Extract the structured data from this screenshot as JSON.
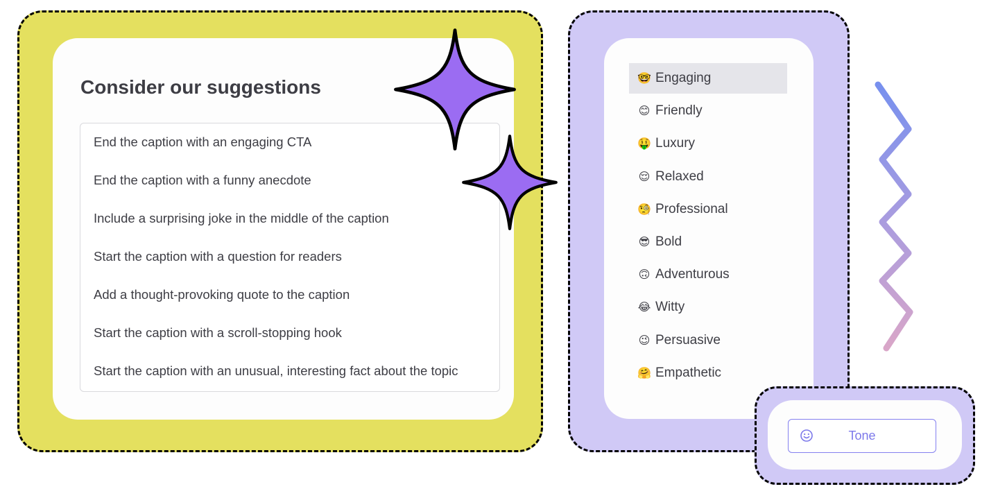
{
  "suggestions": {
    "title": "Consider our suggestions",
    "items": [
      "End the caption with an engaging CTA",
      "End the caption with a funny anecdote",
      "Include a surprising joke in the middle of the caption",
      "Start the caption with a question for readers",
      "Add a thought-provoking quote to the caption",
      "Start the caption with a scroll-stopping hook",
      "Start the caption with an unusual, interesting fact about the topic"
    ]
  },
  "tones": {
    "selected": "Engaging",
    "items": [
      {
        "emoji": "🤓",
        "icon": "nerd-face-icon",
        "label": "Engaging"
      },
      {
        "emoji": "😊",
        "icon": "smiling-face-icon",
        "label": "Friendly"
      },
      {
        "emoji": "🤑",
        "icon": "money-mouth-face-icon",
        "label": "Luxury"
      },
      {
        "emoji": "😌",
        "icon": "relieved-face-icon",
        "label": "Relaxed"
      },
      {
        "emoji": "🧐",
        "icon": "monocle-face-icon",
        "label": "Professional"
      },
      {
        "emoji": "😎",
        "icon": "sunglasses-face-icon",
        "label": "Bold"
      },
      {
        "emoji": "🙃",
        "icon": "upside-down-face-icon",
        "label": "Adventurous"
      },
      {
        "emoji": "😂",
        "icon": "tears-of-joy-face-icon",
        "label": "Witty"
      },
      {
        "emoji": "😉",
        "icon": "winking-face-icon",
        "label": "Persuasive"
      },
      {
        "emoji": "🤗",
        "icon": "hugging-face-icon",
        "label": "Empathetic"
      }
    ]
  },
  "tone_button": {
    "icon": "smiley-icon",
    "label": "Tone"
  },
  "colors": {
    "yellow_frame": "#e4e05f",
    "purple_frame": "#d0c9f6",
    "sparkle": "#9b6cf2",
    "accent": "#7c78ea",
    "selected_row": "#e5e5ea"
  }
}
